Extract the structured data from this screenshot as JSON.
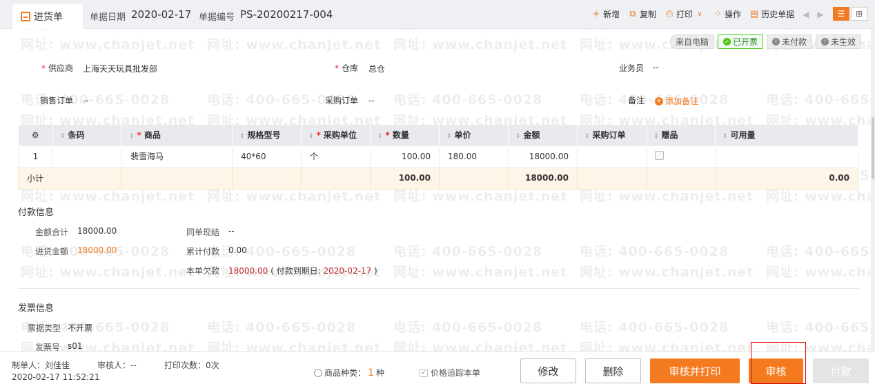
{
  "header": {
    "tab_label": "进货单",
    "date_label": "单据日期",
    "date_value": "2020-02-17",
    "no_label": "单据编号",
    "no_value": "PS-20200217-004"
  },
  "toolbar": {
    "new": "新增",
    "copy": "复制",
    "print": "打印",
    "operate": "操作",
    "history": "历史单据"
  },
  "status": {
    "source": "来自电脑",
    "invoiced": "已开票",
    "unpaid": "未付款",
    "ineffective": "未生效"
  },
  "form": {
    "supplier_label": "供应商",
    "supplier_value": "上海天天玩具批发部",
    "warehouse_label": "仓库",
    "warehouse_value": "总仓",
    "salesman_label": "业务员",
    "salesman_value": "--",
    "sales_order_label": "销售订单",
    "sales_order_value": "--",
    "purchase_order_label": "采购订单",
    "purchase_order_value": "--",
    "remark_label": "备注",
    "add_remark": "添加备注"
  },
  "table": {
    "columns": [
      "条码",
      "商品",
      "规格型号",
      "采购单位",
      "数量",
      "单价",
      "金额",
      "采购订单",
      "赠品",
      "可用量"
    ],
    "rows": [
      {
        "index": "1",
        "barcode": "",
        "product": "裴雪海马",
        "spec": "40*60",
        "unit": "个",
        "qty": "100.00",
        "price": "180.00",
        "amount": "18000.00",
        "po": "",
        "available": ""
      }
    ],
    "subtotal": {
      "label": "小计",
      "qty": "100.00",
      "amount": "18000.00",
      "available": "0.00"
    }
  },
  "payment": {
    "title": "付款信息",
    "total_label": "金额合计",
    "total_value": "18000.00",
    "purchase_amount_label": "进货金额",
    "purchase_amount_value": "18000.00",
    "settle_label": "同单现结",
    "settle_value": "--",
    "paid_label": "累计付款",
    "paid_value": "0.00",
    "due_label": "本单欠款",
    "due_value": "18000.00",
    "due_date_prefix": "( 付款到期日:",
    "due_date_value": "2020-02-17",
    "due_date_suffix": ")"
  },
  "invoice": {
    "title": "发票信息",
    "type_label": "票据类型",
    "type_value": "不开票",
    "no_label": "发票号",
    "no_value": "s01"
  },
  "watermark": {
    "phone": "电话: 400-665-0028",
    "site": "网址: www.chanjet.net"
  },
  "footer": {
    "maker": "制单人：刘佳佳",
    "auditor": "审核人：--",
    "print_count": "打印次数：0次",
    "timestamp": "2020-02-17 11:52:21",
    "kinds_label": "商品种类：",
    "kinds_value": "1",
    "kinds_unit": "种",
    "track_price": "价格追踪本单",
    "btn_edit": "修改",
    "btn_delete": "删除",
    "btn_audit_print": "审核并打印",
    "btn_audit": "审核",
    "btn_pay": "付款"
  },
  "colors": {
    "accent": "#f47a20",
    "ok": "#52c41a",
    "debt": "#c0282d"
  }
}
